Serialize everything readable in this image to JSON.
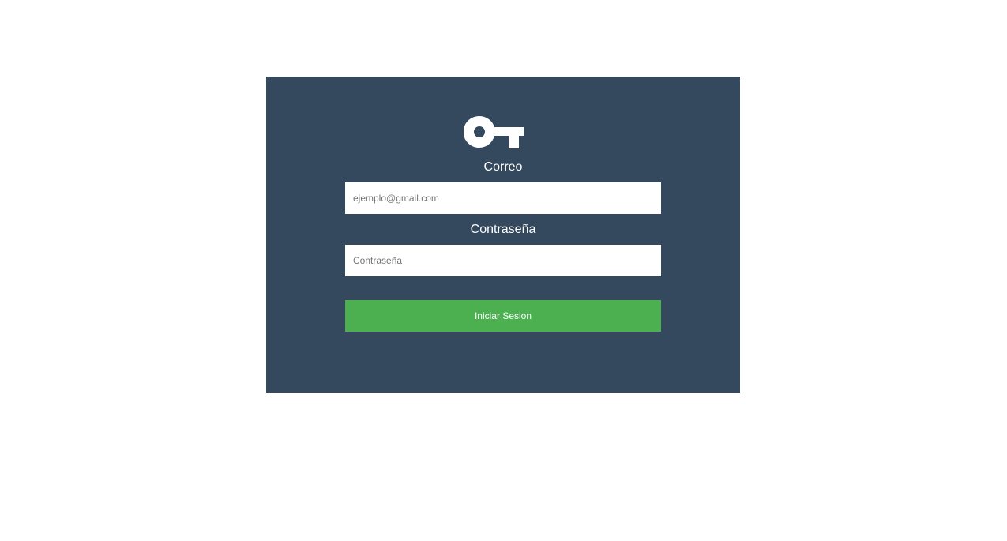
{
  "login": {
    "icon": "key-icon",
    "email_label": "Correo",
    "email_placeholder": "ejemplo@gmail.com",
    "email_value": "",
    "password_label": "Contraseña",
    "password_placeholder": "Contraseña",
    "password_value": "",
    "submit_label": "Iniciar Sesion"
  },
  "colors": {
    "page_background": "#ffffff",
    "card_background": "#34495e",
    "button_background": "#4caf50",
    "text_light": "#ffffff"
  }
}
